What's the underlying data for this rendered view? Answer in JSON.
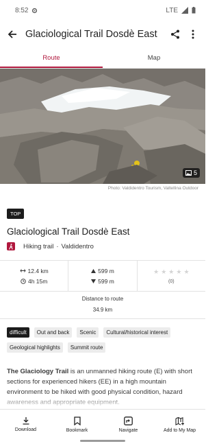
{
  "status_bar": {
    "time": "8:52",
    "network": "LTE"
  },
  "app_bar": {
    "title": "Glaciological Trail Dosdè East",
    "back_icon": "arrow-back-icon",
    "share_icon": "share-icon",
    "more_icon": "more-vert-icon"
  },
  "tabs": [
    {
      "label": "Route",
      "active": true
    },
    {
      "label": "Map",
      "active": false
    }
  ],
  "hero": {
    "photo_count": "5",
    "caption": "Photo: Valdidentro Tourism, Valtellina Outdoor"
  },
  "badge": "TOP",
  "route": {
    "title": "Glaciological Trail Dosdè East",
    "type": "Hiking trail",
    "separator": "·",
    "region": "Valdidentro"
  },
  "stats": {
    "distance": "12.4 km",
    "duration": "4h 15m",
    "ascent": "599 m",
    "descent": "599 m",
    "rating_count": "(0)"
  },
  "distance_to_route": {
    "label": "Distance to route",
    "value": "34.9 km"
  },
  "tags": [
    {
      "label": "difficult",
      "highlight": true
    },
    {
      "label": "Out and back",
      "highlight": false
    },
    {
      "label": "Scenic",
      "highlight": false
    },
    {
      "label": "Cultural/historical interest",
      "highlight": false
    },
    {
      "label": "Geological highlights",
      "highlight": false
    },
    {
      "label": "Summit route",
      "highlight": false
    }
  ],
  "description": {
    "bold": "The Glaciology Trail",
    "text": " is an unmanned hiking route (E) with short sections for experienced hikers (EE) in a high mountain environment to be hiked with good physical condition, hazard awareness and appropriate equipment."
  },
  "bottom_nav": [
    {
      "label": "Download",
      "icon": "download-icon"
    },
    {
      "label": "Bookmark",
      "icon": "bookmark-icon"
    },
    {
      "label": "Navigate",
      "icon": "navigate-icon"
    },
    {
      "label": "Add to My Map",
      "icon": "add-to-map-icon"
    }
  ],
  "colors": {
    "accent": "#b0173d",
    "tag_dark": "#1c1c1c",
    "tag_light": "#ececec"
  }
}
